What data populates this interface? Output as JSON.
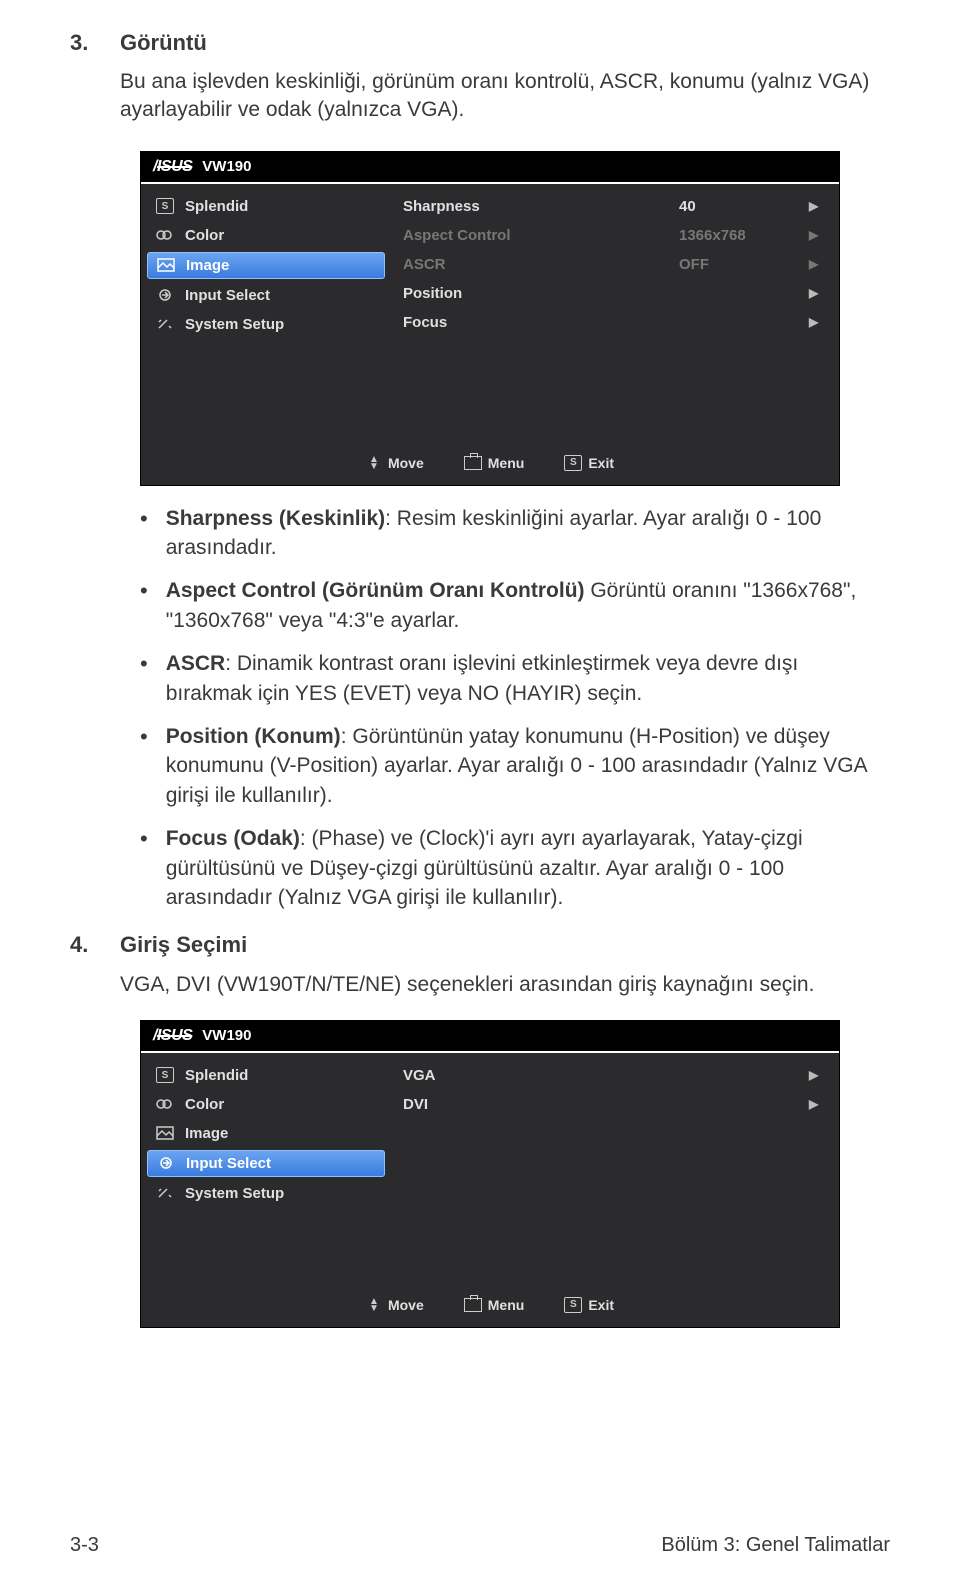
{
  "sec3": {
    "num": "3.",
    "title": "Görüntü"
  },
  "intro3": "Bu ana işlevden keskinliği, görünüm oranı kontrolü, ASCR, konumu (yalnız VGA) ayarlayabilir ve odak (yalnızca VGA).",
  "osd1": {
    "model": "VW190",
    "menu": {
      "splendid": "Splendid",
      "color": "Color",
      "image": "Image",
      "input": "Input Select",
      "system": "System Setup"
    },
    "rows": {
      "sharpness": {
        "label": "Sharpness",
        "value": "40"
      },
      "aspect": {
        "label": "Aspect Control",
        "value": "1366x768"
      },
      "ascr": {
        "label": "ASCR",
        "value": "OFF"
      },
      "position": {
        "label": "Position",
        "value": ""
      },
      "focus": {
        "label": "Focus",
        "value": ""
      }
    },
    "footer": {
      "move": "Move",
      "menu": "Menu",
      "exit": "Exit"
    }
  },
  "bullets": {
    "b1a": "Sharpness (Keskinlik)",
    "b1b": ": Resim keskinliğini ayarlar. Ayar aralığı 0 - 100 arasındadır.",
    "b2a": "Aspect Control (Görünüm Oranı Kontrolü)",
    "b2b": " Görüntü oranını \"1366x768\", \"1360x768\" veya \"4:3\"e ayarlar.",
    "b3a": "ASCR",
    "b3b": ": Dinamik kontrast oranı işlevini etkinleştirmek veya devre dışı bırakmak için YES (EVET) veya NO (HAYIR) seçin.",
    "b4a": "Position (Konum)",
    "b4b": ": Görüntünün yatay konumunu (H-Position) ve düşey konumunu (V-Position) ayarlar. Ayar aralığı 0 - 100 arasındadır (Yalnız VGA girişi ile kullanılır).",
    "b5a": "Focus (Odak)",
    "b5b": ": (Phase) ve (Clock)'i ayrı ayrı ayarlayarak, Yatay-çizgi gürültüsünü ve Düşey-çizgi gürültüsünü azaltır. Ayar aralığı 0 - 100 arasındadır (Yalnız VGA girişi ile kullanılır)."
  },
  "sec4": {
    "num": "4.",
    "title": "Giriş Seçimi"
  },
  "sub4": "VGA, DVI (VW190T/N/TE/NE) seçenekleri arasından giriş kaynağını seçin.",
  "osd2": {
    "model": "VW190",
    "menu": {
      "splendid": "Splendid",
      "color": "Color",
      "image": "Image",
      "input": "Input Select",
      "system": "System Setup"
    },
    "rows": {
      "vga": {
        "label": "VGA"
      },
      "dvi": {
        "label": "DVI"
      }
    },
    "footer": {
      "move": "Move",
      "menu": "Menu",
      "exit": "Exit"
    }
  },
  "footer": {
    "left": "3-3",
    "right": "Bölüm 3: Genel Talimatlar"
  },
  "keyS": "S",
  "chart_data": {
    "type": "table",
    "title": "OSD Image menu values",
    "categories": [
      "Sharpness",
      "Aspect Control",
      "ASCR",
      "Position",
      "Focus"
    ],
    "values": [
      "40",
      "1366x768",
      "OFF",
      "",
      ""
    ]
  }
}
